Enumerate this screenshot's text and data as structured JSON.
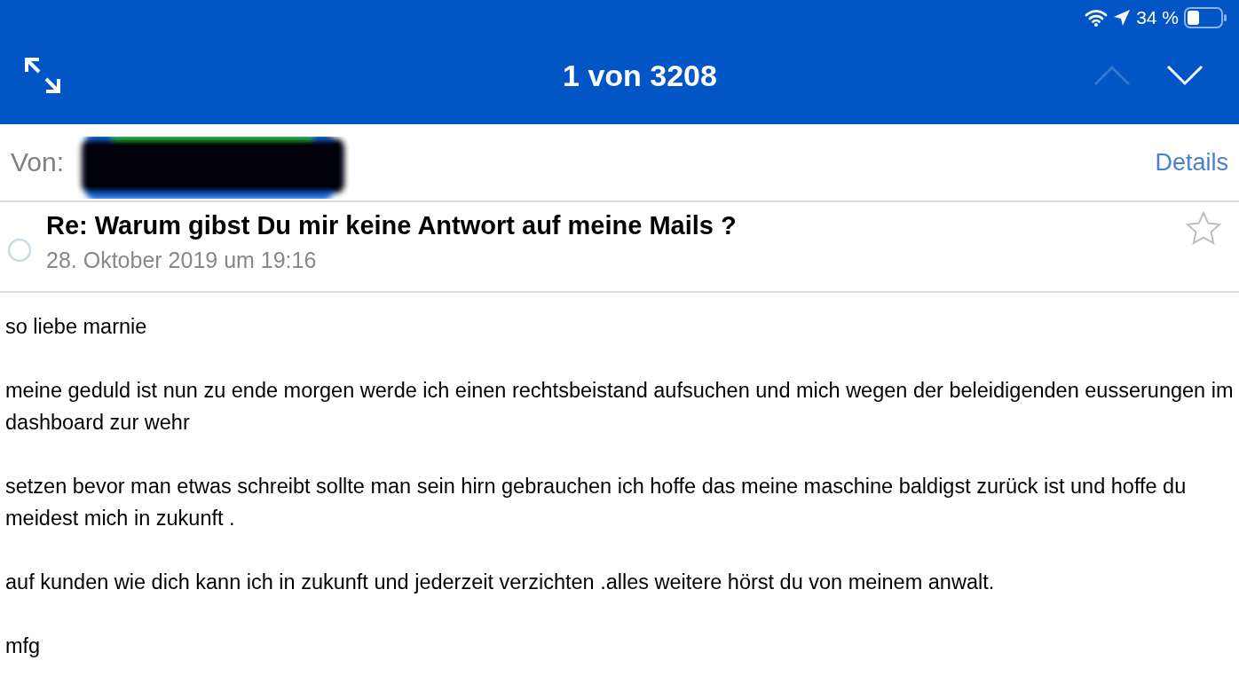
{
  "status_bar": {
    "battery": "34 %"
  },
  "nav": {
    "title": "1 von 3208",
    "prev_disabled": true,
    "next_disabled": false
  },
  "sender": {
    "label": "Von:",
    "details": "Details"
  },
  "message": {
    "subject": "Re: Warum gibst Du mir keine Antwort auf meine Mails ?",
    "date": "28. Oktober 2019 um 19:16",
    "starred": false
  },
  "body": [
    "so liebe marnie",
    "meine geduld ist nun zu ende morgen werde ich einen rechtsbeistand aufsuchen und mich wegen der beleidigenden eusserungen im dashboard zur wehr",
    "setzen bevor man etwas schreibt sollte man sein hirn gebrauchen ich hoffe das meine maschine baldigst zurück ist und hoffe du meidest mich in zukunft .",
    "auf kunden wie dich kann ich in zukunft und jederzeit verzichten .alles weitere hörst du von meinem anwalt.",
    "mfg"
  ]
}
